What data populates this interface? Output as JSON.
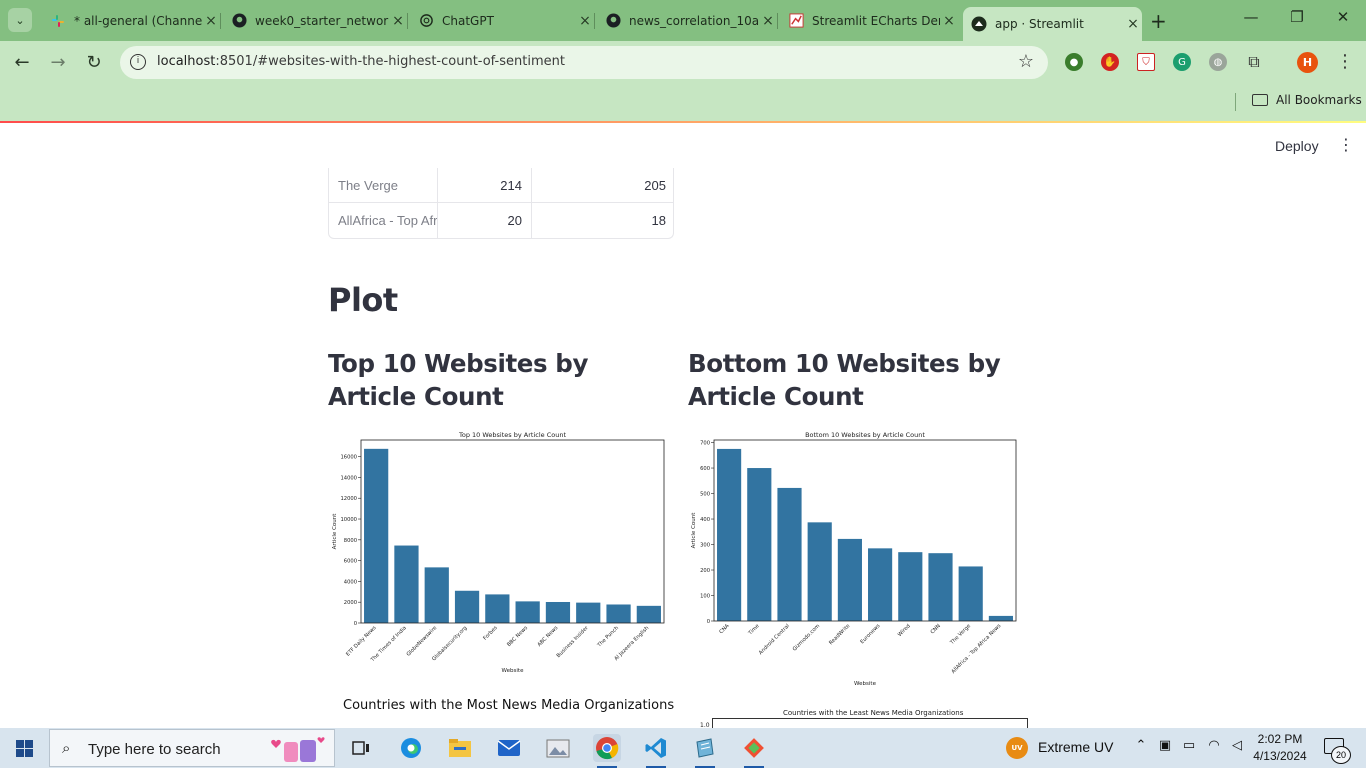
{
  "browser": {
    "tabs": [
      {
        "label": "* all-general (Channel",
        "icon": "slack-icon"
      },
      {
        "label": "week0_starter_networ",
        "icon": "github-icon"
      },
      {
        "label": "ChatGPT",
        "icon": "chatgpt-icon"
      },
      {
        "label": "news_correlation_10a",
        "icon": "github-icon"
      },
      {
        "label": "Streamlit ECharts Der",
        "icon": "chart-icon"
      },
      {
        "label": "app · Streamlit",
        "icon": "streamlit-icon"
      }
    ],
    "url_host": "localhost",
    "url_path": ":8501/#websites-with-the-highest-count-of-sentiment",
    "bookmarks_label": "All Bookmarks",
    "profile_initial": "H"
  },
  "streamlit": {
    "deploy_label": "Deploy"
  },
  "table": {
    "rows": [
      {
        "site": "The Verge",
        "v1": "214",
        "v2": "205"
      },
      {
        "site": "AllAfrica - Top Afr",
        "v1": "20",
        "v2": "18"
      }
    ]
  },
  "headings": {
    "plot": "Plot",
    "top": "Top 10 Websites by Article Count",
    "bottom": "Bottom 10 Websites by Article Count"
  },
  "captions": {
    "countries_most": "Countries with the Most News Media Organizations",
    "countries_least": "Countries with the Least News Media Organizations",
    "least_first_tick": "1.0"
  },
  "chart_data": [
    {
      "type": "bar",
      "title": "Top 10 Websites by Article Count",
      "xlabel": "Website",
      "ylabel": "Article Count",
      "categories": [
        "ETF Daily News",
        "The Times of India",
        "GlobeNewswire",
        "Globalsecurity.org",
        "Forbes",
        "BBC News",
        "ABC News",
        "Business Insider",
        "The Punch",
        "Al Jazeera English"
      ],
      "values": [
        16750,
        7450,
        5350,
        3100,
        2750,
        2080,
        2020,
        1960,
        1780,
        1650
      ],
      "yticks": [
        0,
        2000,
        4000,
        6000,
        8000,
        10000,
        12000,
        14000,
        16000
      ],
      "ylim": [
        0,
        17600
      ],
      "color": "#3274a1"
    },
    {
      "type": "bar",
      "title": "Bottom 10 Websites by Article Count",
      "xlabel": "Website",
      "ylabel": "Article Count",
      "categories": [
        "CNA",
        "Time",
        "Android Central",
        "Gizmodo.com",
        "ReadWrite",
        "Euronews",
        "Wired",
        "CNN",
        "The Verge",
        "AllAfrica - Top Africa News"
      ],
      "values": [
        675,
        600,
        522,
        387,
        322,
        285,
        270,
        266,
        214,
        20
      ],
      "yticks": [
        0,
        100,
        200,
        300,
        400,
        500,
        600,
        700
      ],
      "ylim": [
        0,
        710
      ],
      "color": "#3274a1"
    }
  ],
  "taskbar": {
    "search_placeholder": "Type here to search",
    "weather_label": "Extreme UV",
    "uv_badge": "UV",
    "time": "2:02 PM",
    "date": "4/13/2024",
    "notifications": "20"
  }
}
